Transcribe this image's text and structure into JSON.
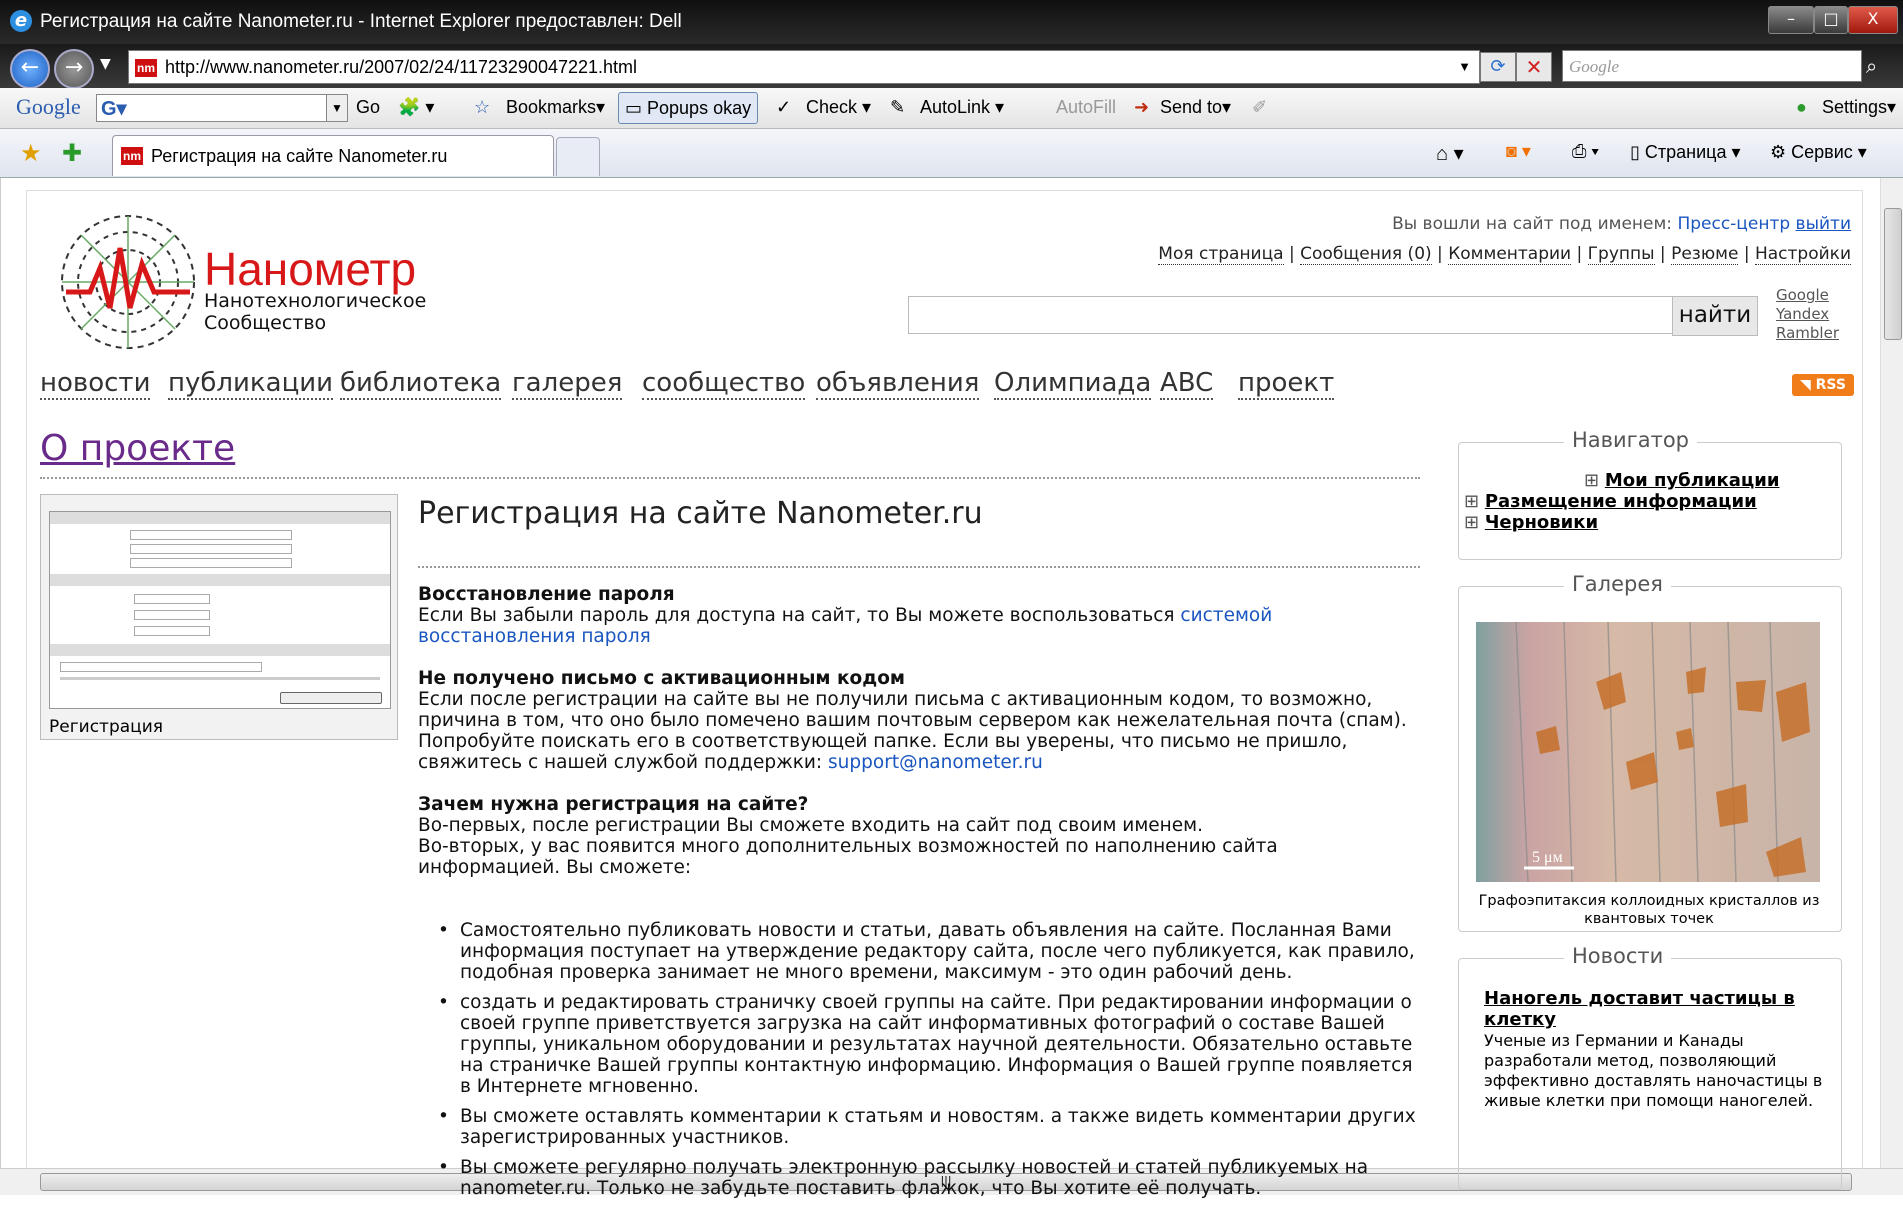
{
  "window": {
    "title": "Регистрация на сайте Nanometer.ru - Internet Explorer предоставлен: Dell",
    "url": "http://www.nanometer.ru/2007/02/24/11723290047221.html",
    "search_placeholder": "Google",
    "min": "–",
    "max": "□",
    "close": "X"
  },
  "toolbar": {
    "google_logo": "Google",
    "go": "Go",
    "bookmarks": "Bookmarks▾",
    "popups": "Popups okay",
    "check": "Check ▾",
    "autolink": "AutoLink ▾",
    "autofill": "AutoFill",
    "sendto": "Send to▾",
    "settings": "Settings▾"
  },
  "tabs": {
    "active_tab": "Регистрация на сайте Nanometer.ru",
    "page_menu": "Страница ▾",
    "tools_menu": "Сервис ▾"
  },
  "header": {
    "logo_title": "Нанометр",
    "logo_sub1": "Нанотехнологическое",
    "logo_sub2": "Сообщество",
    "logged_in_as": "Вы вошли на сайт под именем:",
    "username": "Пресс-центр",
    "logout": "выйти",
    "user_links": [
      "Моя страница",
      "Сообщения (0)",
      "Комментарии",
      "Группы",
      "Резюме",
      "Настройки"
    ],
    "search_button": "найти",
    "engines": [
      "Google",
      "Yandex",
      "Rambler"
    ]
  },
  "menu": [
    "новости",
    "публикации",
    "библиотека",
    "галерея",
    "сообщество",
    "объявления",
    "Олимпиада",
    "ABC",
    "проект"
  ],
  "rss": "RSS",
  "main": {
    "section_title": "О проекте",
    "thumb_caption": "Регистрация",
    "article_title": "Регистрация на сайте Nanometer.ru",
    "h1": "Восстановление пароля",
    "p1": "Если Вы забыли пароль для доступа на сайт, то Вы можете воспользоваться ",
    "p1_link": "системой восстановления пароля",
    "h2": "Не получено письмо с активационным кодом",
    "p2": "Если после регистрации на сайте вы не получили письма с активационным кодом, то возможно, причина в том, что оно было помечено вашим почтовым сервером как нежелательная почта (спам). Попробуйте поискать его в соответствующей папке. Если вы уверены, что письмо не пришло, свяжитесь с нашей службой поддержки: ",
    "p2_link": "support@nanometer.ru",
    "h3": "Зачем нужна регистрация на сайте?",
    "p3a": "Во-первых, после регистрации Вы сможете входить на сайт под своим именем.",
    "p3b": "Во-вторых, у вас появится много дополнительных возможностей по наполнению сайта информацией. Вы сможете:",
    "features": [
      "Самостоятельно публиковать новости и статьи, давать объявления на сайте. Посланная Вами информация поступает на утверждение редактору сайта, после чего публикуется, как правило, подобная проверка занимает не много времени, максимум - это один рабочий день.",
      "создать и редактировать страничку своей группы на сайте. При редактировании информации о своей группе приветствуется загрузка на сайт информативных фотографий о составе Вашей группы, уникальном оборудовании и результатах научной деятельности. Обязательно оставьте на страничке Вашей группы контактную информацию. Информация о Вашей группе появляется в Интернете мгновенно.",
      "Вы сможете оставлять комментарии к статьям и новостям. а также видеть комментарии других зарегистрированных участников.",
      "Вы сможете регулярно получать электронную рассылку новостей и статей публикуемых на nanometer.ru. Только не забудьте поставить флажок, что Вы хотите её получать."
    ]
  },
  "sidebar": {
    "nav_title": "Навигатор",
    "nav_items": [
      "Мои публикации",
      "Размещение информации",
      "Черновики"
    ],
    "gallery_title": "Галерея",
    "gallery_scale": "5 μм",
    "gallery_caption": "Графоэпитаксия коллоидных кристаллов из квантовых точек",
    "news_title": "Новости",
    "news_headline": "Наногель доставит частицы в клетку",
    "news_text": "Ученые из Германии и Канады разработали метод, позволяющий эффективно доставлять наночастицы в живые клетки при помощи наногелей."
  },
  "colors": {
    "brand_red": "#d81818",
    "link_blue": "#1a56c0"
  }
}
